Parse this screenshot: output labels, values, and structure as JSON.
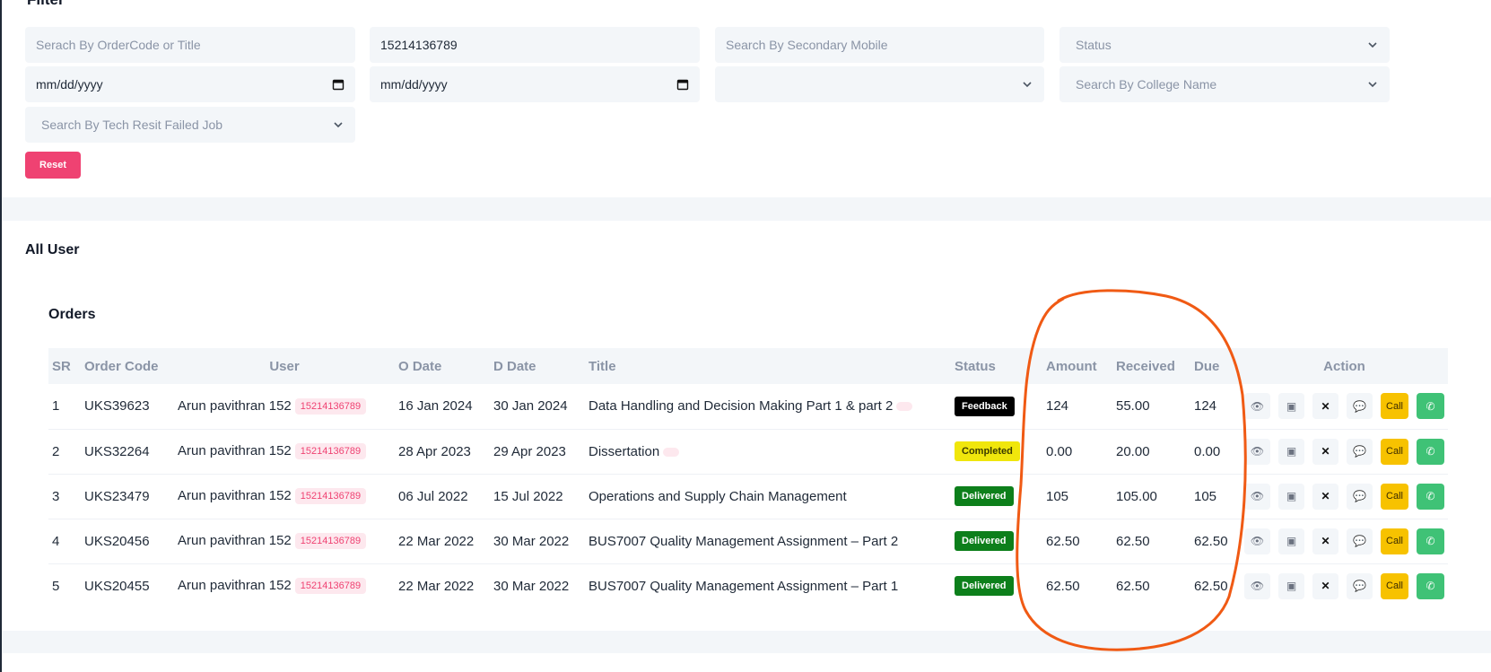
{
  "filter": {
    "title": "Filter",
    "order_search_placeholder": "Serach By OrderCode or Title",
    "mobile_value": "15214136789",
    "secondary_mobile_placeholder": "Search By Secondary Mobile",
    "status_placeholder": "Status",
    "from_date_placeholder": "mm/dd/yyyy",
    "to_date_placeholder": "mm/dd/yyyy",
    "blank_select_value": "",
    "college_placeholder": "Search By College Name",
    "tech_resit_placeholder": "Search By Tech Resit Failed Job",
    "reset_label": "Reset"
  },
  "users": {
    "title": "All User",
    "orders_title": "Orders",
    "columns": {
      "sr": "SR",
      "order_code": "Order Code",
      "user": "User",
      "o_date": "O Date",
      "d_date": "D Date",
      "title": "Title",
      "status": "Status",
      "amount": "Amount",
      "received": "Received",
      "due": "Due",
      "action": "Action"
    },
    "call_label": "Call",
    "rows": [
      {
        "sr": "1",
        "order_code": "UKS39623",
        "user": "Arun pavithran 152",
        "mobile": "15214136789",
        "o_date": "16 Jan 2024",
        "d_date": "30 Jan 2024",
        "title": "Data Handling and Decision Making Part 1 & part 2",
        "status": "Feedback",
        "status_kind": "feedback",
        "amount": "124",
        "received": "55.00",
        "due": "124"
      },
      {
        "sr": "2",
        "order_code": "UKS32264",
        "user": "Arun pavithran 152",
        "mobile": "15214136789",
        "o_date": "28 Apr 2023",
        "d_date": "29 Apr 2023",
        "title": "Dissertation",
        "status": "Completed",
        "status_kind": "completed",
        "amount": "0.00",
        "received": "20.00",
        "due": "0.00"
      },
      {
        "sr": "3",
        "order_code": "UKS23479",
        "user": "Arun pavithran 152",
        "mobile": "15214136789",
        "o_date": "06 Jul 2022",
        "d_date": "15 Jul 2022",
        "title": "Operations and Supply Chain Management",
        "status": "Delivered",
        "status_kind": "delivered",
        "amount": "105",
        "received": "105.00",
        "due": "105"
      },
      {
        "sr": "4",
        "order_code": "UKS20456",
        "user": "Arun pavithran 152",
        "mobile": "15214136789",
        "o_date": "22 Mar 2022",
        "d_date": "30 Mar 2022",
        "title": "BUS7007 Quality Management Assignment – Part 2",
        "status": "Delivered",
        "status_kind": "delivered",
        "amount": "62.50",
        "received": "62.50",
        "due": "62.50"
      },
      {
        "sr": "5",
        "order_code": "UKS20455",
        "user": "Arun pavithran 152",
        "mobile": "15214136789",
        "o_date": "22 Mar 2022",
        "d_date": "30 Mar 2022",
        "title": "BUS7007 Quality Management Assignment – Part 1",
        "status": "Delivered",
        "status_kind": "delivered",
        "amount": "62.50",
        "received": "62.50",
        "due": "62.50"
      }
    ]
  },
  "colors": {
    "reset": "#ef4272",
    "feedback": "#000000",
    "completed": "#f0e60c",
    "delivered": "#0d7f1b",
    "call": "#f7c200",
    "phone": "#3fc276",
    "annotation": "#f05a14"
  },
  "icons": [
    "calendar-icon",
    "chevron-down-icon",
    "eye-icon",
    "payment-icon",
    "close-icon",
    "chat-icon",
    "phone-icon"
  ]
}
